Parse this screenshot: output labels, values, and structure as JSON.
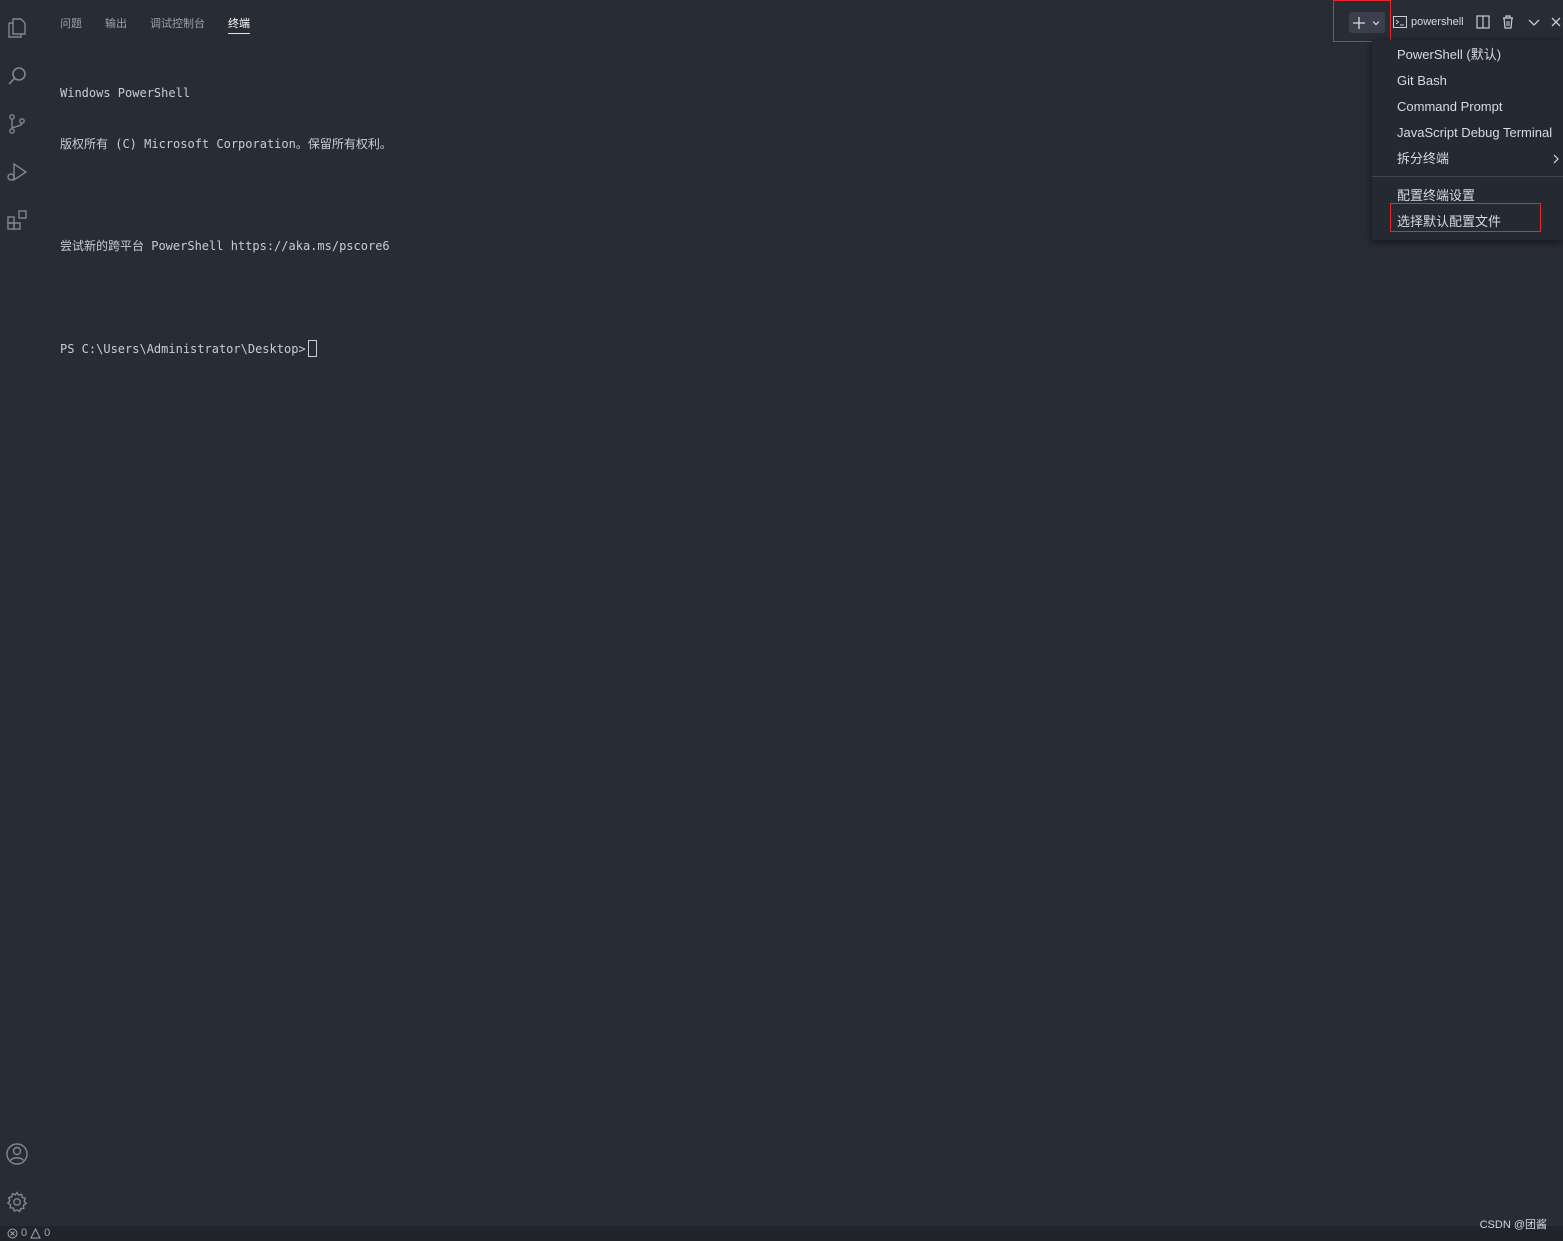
{
  "panel": {
    "tabs": [
      {
        "label": "问题"
      },
      {
        "label": "输出"
      },
      {
        "label": "调试控制台"
      },
      {
        "label": "终端"
      }
    ]
  },
  "toolbar": {
    "terminal_name": "powershell",
    "new_terminal_icon": "plus-icon",
    "dropdown_icon": "chevron-down-icon",
    "split_icon": "split-editor-icon",
    "trash_icon": "trash-icon",
    "maximize_icon": "chevron-down-icon",
    "close_icon": "close-icon"
  },
  "terminal": {
    "lines": [
      "Windows PowerShell",
      "版权所有 (C) Microsoft Corporation。保留所有权利。",
      "",
      "尝试新的跨平台 PowerShell https://aka.ms/pscore6",
      "",
      "PS C:\\Users\\Administrator\\Desktop>"
    ]
  },
  "menu": {
    "items": [
      {
        "label": "PowerShell (默认)"
      },
      {
        "label": "Git Bash"
      },
      {
        "label": "Command Prompt"
      },
      {
        "label": "JavaScript Debug Terminal"
      },
      {
        "label": "拆分终端"
      },
      {
        "label": "配置终端设置"
      },
      {
        "label": "选择默认配置文件"
      }
    ]
  },
  "status": {
    "errors": "0",
    "warnings": "0"
  },
  "watermark": "CSDN @团酱",
  "colors": {
    "background": "#282c34",
    "highlight_box": "#e8262b",
    "menu_bg": "#252932"
  }
}
